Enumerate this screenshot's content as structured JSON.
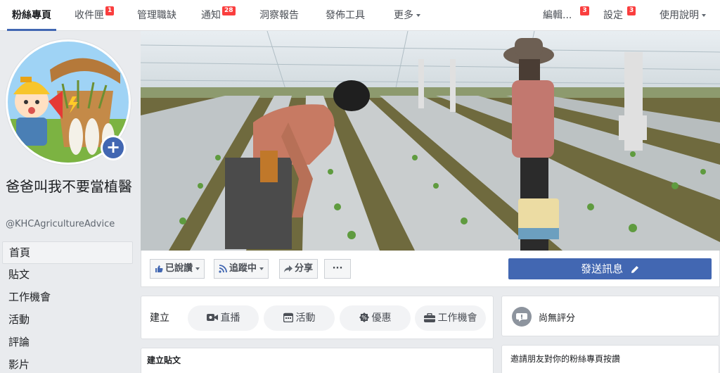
{
  "topbar": {
    "tabs": [
      {
        "label": "粉絲專頁",
        "badge": ""
      },
      {
        "label": "收件匣",
        "badge": "1"
      },
      {
        "label": "管理職缺",
        "badge": ""
      },
      {
        "label": "通知",
        "badge": "28"
      },
      {
        "label": "洞察報告",
        "badge": ""
      },
      {
        "label": "發佈工具",
        "badge": ""
      },
      {
        "label": "更多",
        "badge": ""
      }
    ],
    "edit": {
      "label": "編輯...",
      "badge": "3"
    },
    "settings": {
      "label": "設定",
      "badge": "3"
    },
    "help": {
      "label": "使用說明"
    }
  },
  "profile": {
    "name": "爸爸叫我不要當植醫",
    "handle": "@KHCAgricultureAdvice",
    "add_photo_symbol": "+"
  },
  "nav": {
    "items": [
      "首頁",
      "貼文",
      "工作機會",
      "活動",
      "評論",
      "影片"
    ]
  },
  "actions": {
    "like": "已說讚",
    "follow": "追蹤中",
    "share": "分享",
    "more": "···",
    "send_message": "發送訊息"
  },
  "create": {
    "label": "建立",
    "pills": [
      "直播",
      "活動",
      "優惠",
      "工作機會"
    ]
  },
  "post_card": {
    "title": "建立貼文"
  },
  "rating": {
    "text": "尚無評分"
  },
  "invite": {
    "title": "邀請朋友對你的粉絲專頁按讚"
  },
  "colors": {
    "brand": "#4267b2",
    "badge": "#fa3e3e",
    "background": "#e9ebee"
  },
  "icons": [
    "thumbs-up-icon",
    "rss-icon",
    "share-arrow-icon",
    "pencil-icon",
    "video-camera-icon",
    "calendar-icon",
    "percent-tag-icon",
    "briefcase-icon",
    "chat-bubble-icon",
    "plus-icon"
  ]
}
